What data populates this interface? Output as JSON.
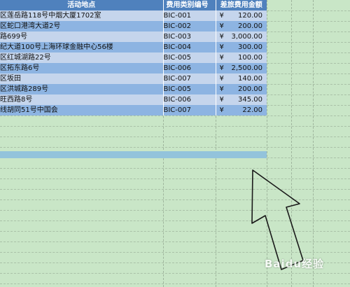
{
  "sheet": {
    "headers": {
      "location": "活动地点",
      "code": "费用类别编号",
      "amount": "差旅费用金额"
    },
    "currency_symbol": "¥",
    "rows": [
      {
        "location": "区莲岳路118号中烟大厦1702室",
        "code": "BIC-001",
        "amount": "120.00"
      },
      {
        "location": "区蛇口港湾大道2号",
        "code": "BIC-002",
        "amount": "200.00"
      },
      {
        "location": "路699号",
        "code": "BIC-003",
        "amount": "3,000.00"
      },
      {
        "location": "纪大道100号上海环球金融中心56楼",
        "code": "BIC-004",
        "amount": "300.00"
      },
      {
        "location": "区红城湖路22号",
        "code": "BIC-005",
        "amount": "100.00"
      },
      {
        "location": "区拓东路6号",
        "code": "BIC-006",
        "amount": "2,500.00"
      },
      {
        "location": "区坂田",
        "code": "BIC-007",
        "amount": "140.00"
      },
      {
        "location": "区洪城路289号",
        "code": "BIC-005",
        "amount": "200.00"
      },
      {
        "location": "旺西路8号",
        "code": "BIC-006",
        "amount": "345.00"
      },
      {
        "location": "线胡同51号中国会",
        "code": "BIC-007",
        "amount": "22.00"
      }
    ]
  },
  "watermark": {
    "text": "Baidu经验"
  },
  "colors": {
    "header": "#4f81bd",
    "row_light": "#c5d5ec",
    "row_dark": "#8db4e2",
    "background": "#c9e6c7"
  }
}
